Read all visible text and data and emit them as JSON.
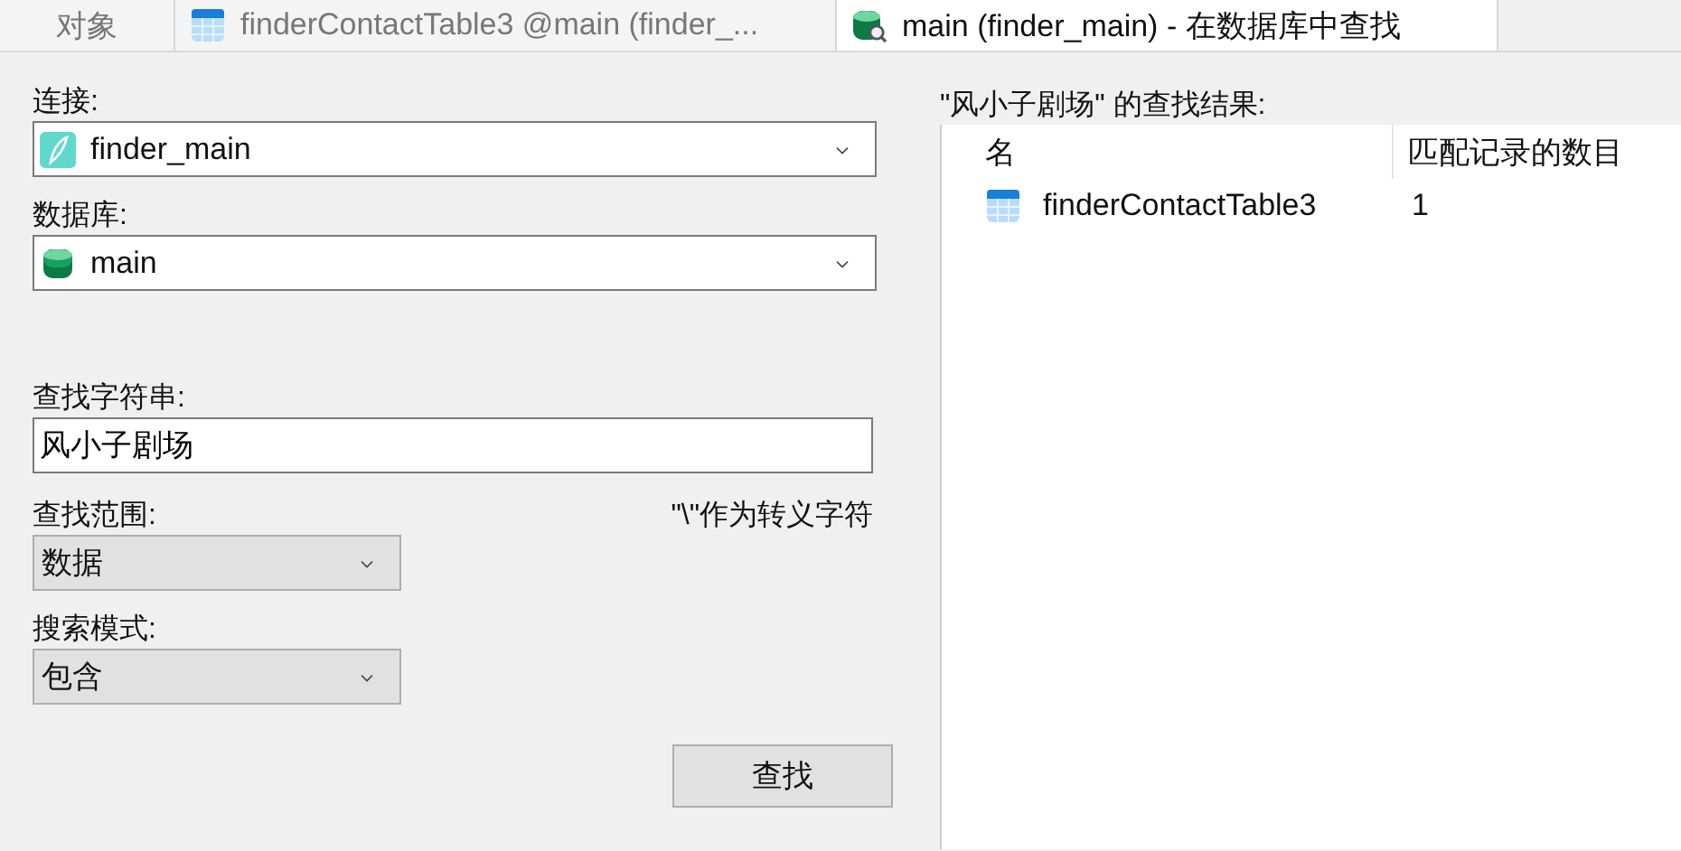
{
  "tabs": [
    {
      "label": "对象",
      "kind": "plain",
      "selected": false
    },
    {
      "label": "finderContactTable3 @main (finder_...",
      "kind": "table",
      "selected": false
    },
    {
      "label": "main (finder_main) - 在数据库中查找",
      "kind": "database-search",
      "selected": true
    }
  ],
  "form": {
    "connection": {
      "label": "连接:",
      "value": "finder_main",
      "kind": "connection"
    },
    "database": {
      "label": "数据库:",
      "value": "main",
      "kind": "database"
    },
    "search_string": {
      "label": "查找字符串:",
      "value": "风小子剧场"
    },
    "scope": {
      "label": "查找范围:",
      "value": "数据"
    },
    "escape_note": "\"\\\"作为转义字符",
    "mode": {
      "label": "搜索模式:",
      "value": "包含"
    },
    "find_button": "查找"
  },
  "results": {
    "title": "\"风小子剧场\" 的查找结果:",
    "columns": [
      "名",
      "匹配记录的数目"
    ],
    "rows": [
      {
        "name": "finderContactTable3",
        "count": "1",
        "kind": "table"
      }
    ]
  }
}
